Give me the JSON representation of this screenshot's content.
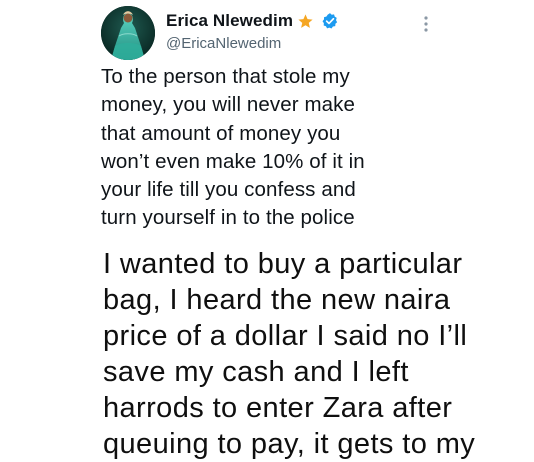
{
  "profile": {
    "display_name": "Erica Nlewedim",
    "handle": "@EricaNlewedim",
    "avatar_icon": "profile-photo",
    "badges": [
      "star-emoji-icon",
      "verified-badge-icon"
    ],
    "verified_color": "#1d9bf0",
    "star_color": "#f5a623"
  },
  "tweet": {
    "text": "To the person that stole my\nmoney, you will never make\nthat amount of money you\nwon’t even make 10% of it in\nyour life till you confess and\nturn yourself in to the police",
    "more_icon": "more-vertical-icon"
  },
  "caption": {
    "text": "I wanted to buy a particular\nbag, I heard the new naira\nprice of a dollar I said no I’ll\nsave my cash and I left\nharrods to enter Zara after\nqueuing to pay, it gets to my"
  }
}
